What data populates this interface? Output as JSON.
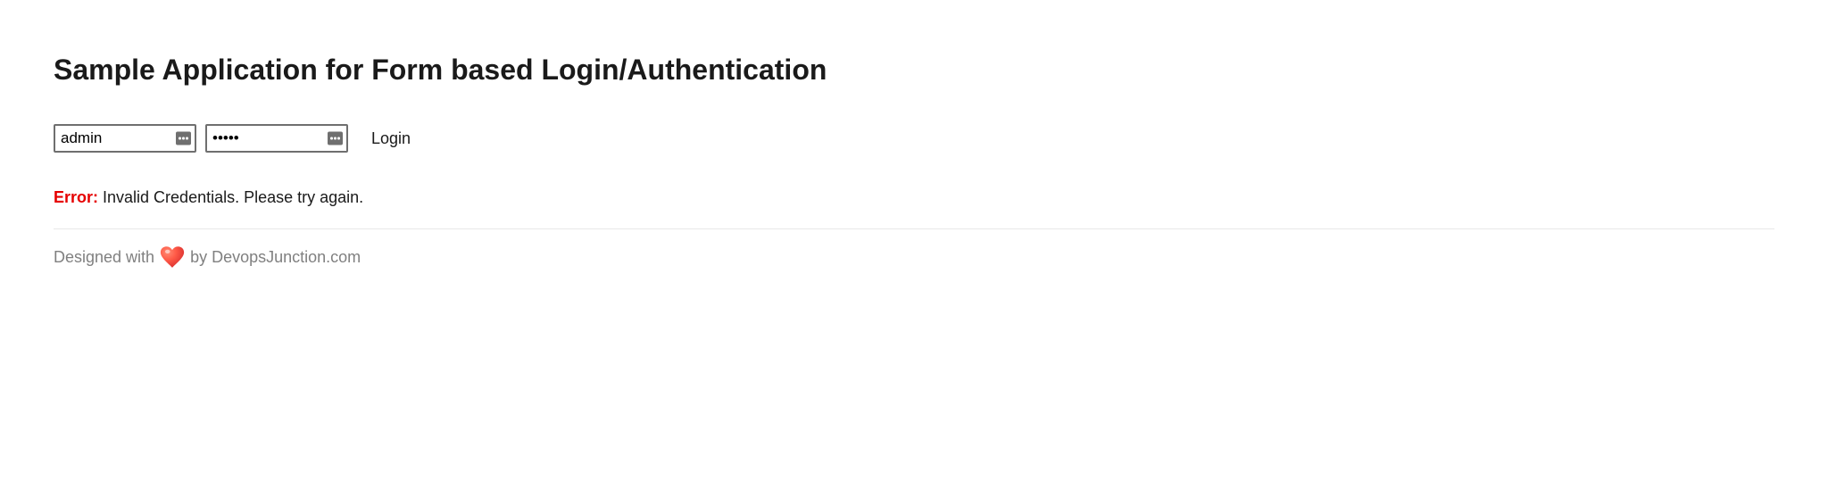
{
  "page": {
    "title": "Sample Application for Form based Login/Authentication"
  },
  "form": {
    "username_value": "admin",
    "password_value": "•••••",
    "login_label": "Login"
  },
  "error": {
    "label": "Error:",
    "message": " Invalid Credentials. Please try again."
  },
  "footer": {
    "prefix": "Designed with",
    "suffix": "by DevopsJunction.com"
  }
}
